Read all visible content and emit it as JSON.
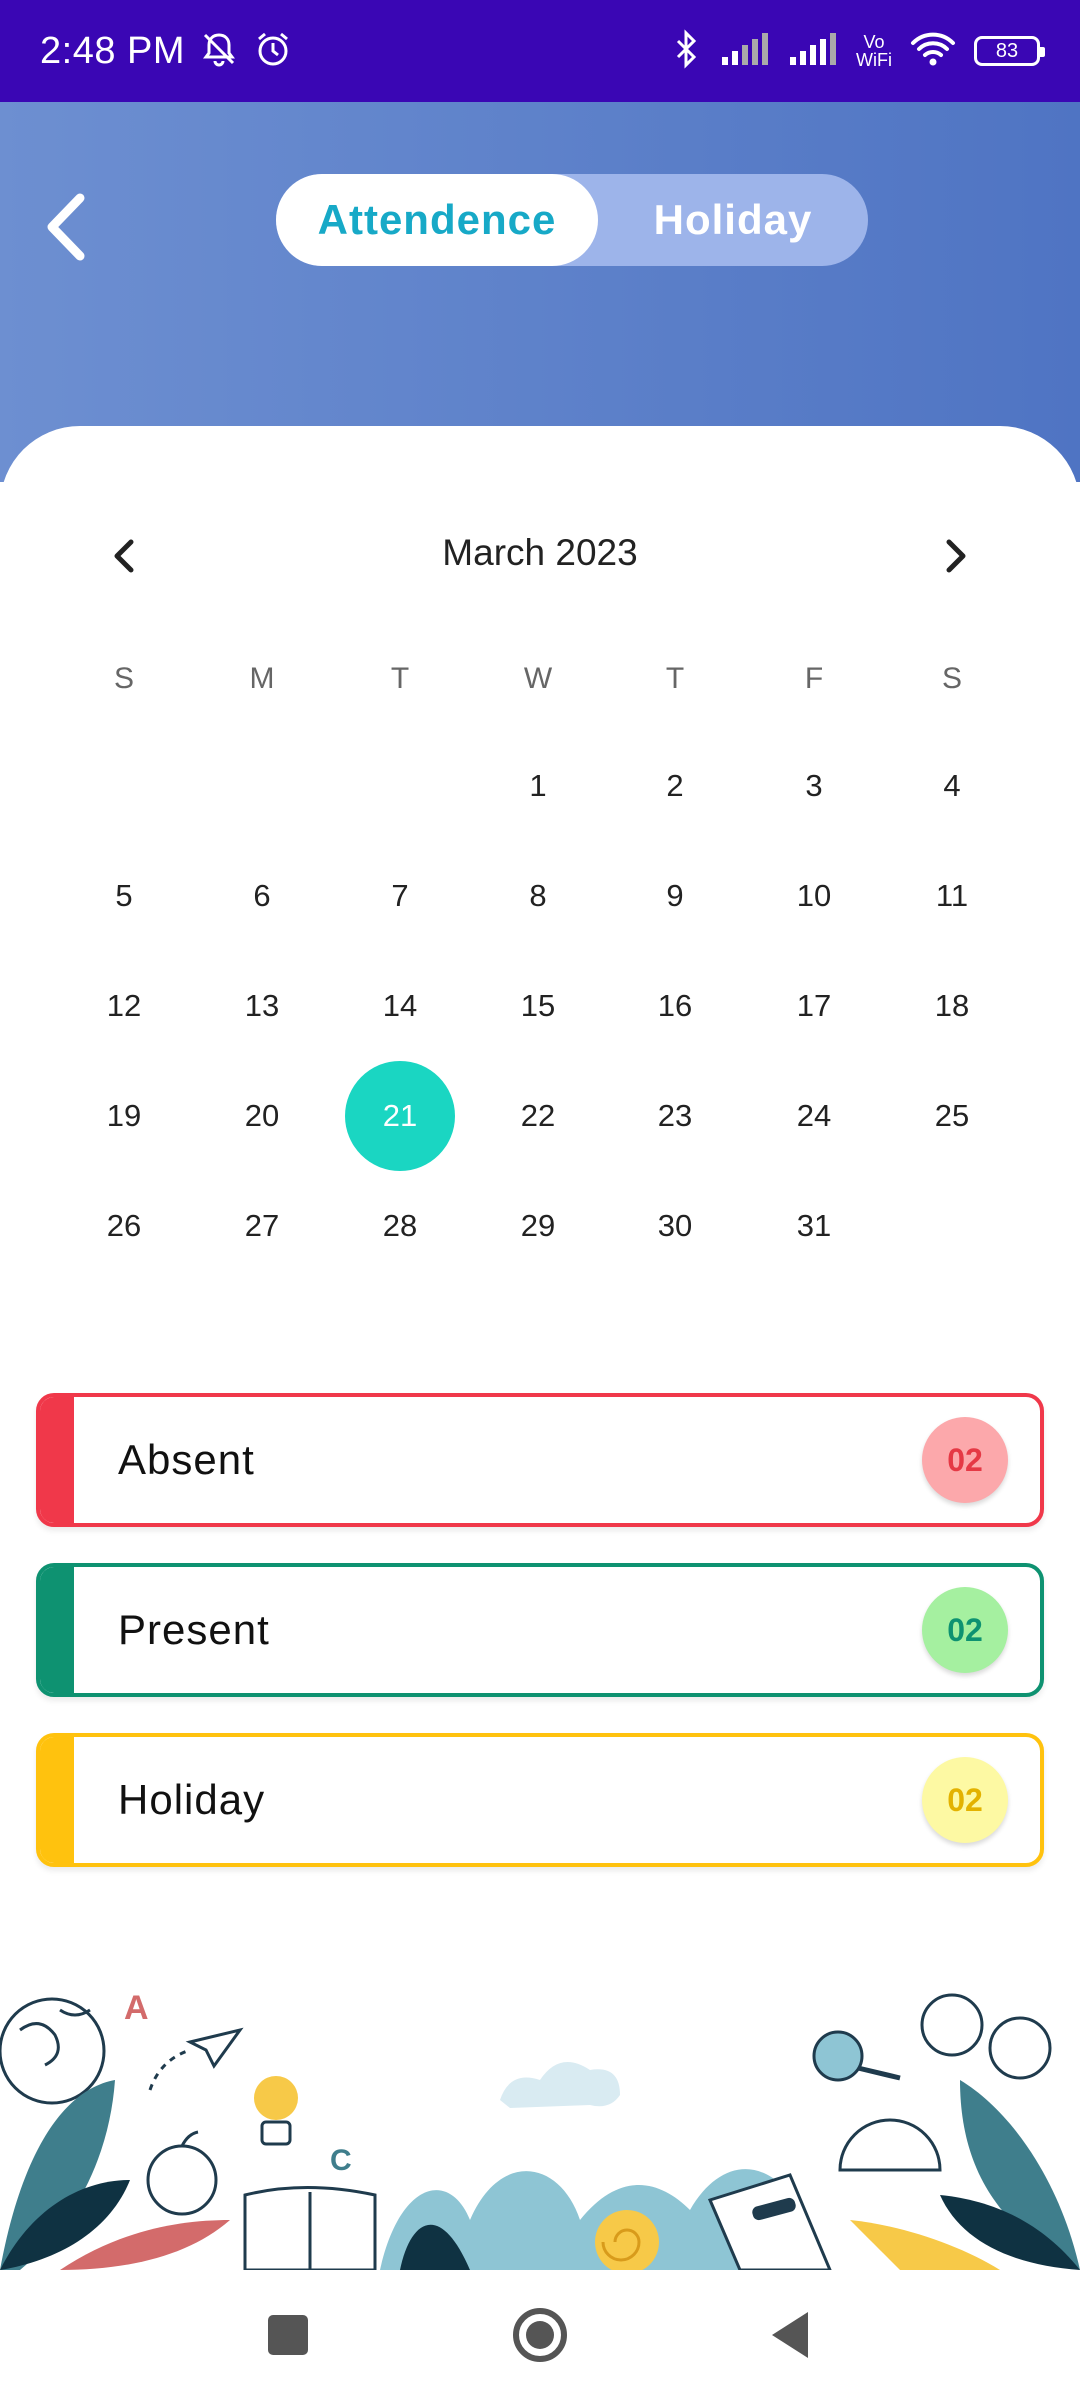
{
  "status_bar": {
    "time": "2:48 PM",
    "vo_wifi_top": "Vo",
    "vo_wifi_bottom": "WiFi",
    "battery": "83"
  },
  "header": {
    "tabs": [
      {
        "label": "Attendence",
        "active": true
      },
      {
        "label": "Holiday",
        "active": false
      }
    ]
  },
  "calendar": {
    "month_title": "March 2023",
    "weekdays": [
      "S",
      "M",
      "T",
      "W",
      "T",
      "F",
      "S"
    ],
    "selected_day": "21",
    "selected_color": "#1ad6c2",
    "weeks": [
      [
        "",
        "",
        "",
        "1",
        "2",
        "3",
        "4"
      ],
      [
        "5",
        "6",
        "7",
        "8",
        "9",
        "10",
        "11"
      ],
      [
        "12",
        "13",
        "14",
        "15",
        "16",
        "17",
        "18"
      ],
      [
        "19",
        "20",
        "21",
        "22",
        "23",
        "24",
        "25"
      ],
      [
        "26",
        "27",
        "28",
        "29",
        "30",
        "31",
        ""
      ]
    ]
  },
  "legend": [
    {
      "label": "Absent",
      "count": "02",
      "color": "#f0384a",
      "badge_bg": "#fca8ab",
      "badge_text": "#e53945"
    },
    {
      "label": "Present",
      "count": "02",
      "color": "#0e9271",
      "badge_bg": "#a5f0a0",
      "badge_text": "#0e9271"
    },
    {
      "label": "Holiday",
      "count": "02",
      "color": "#ffc20e",
      "badge_bg": "#fdf9a3",
      "badge_text": "#e3b200"
    }
  ],
  "illustration": {
    "letters": [
      "A",
      "C"
    ]
  },
  "navbar": {
    "buttons": [
      "recents-button",
      "home-button",
      "back-button"
    ]
  }
}
